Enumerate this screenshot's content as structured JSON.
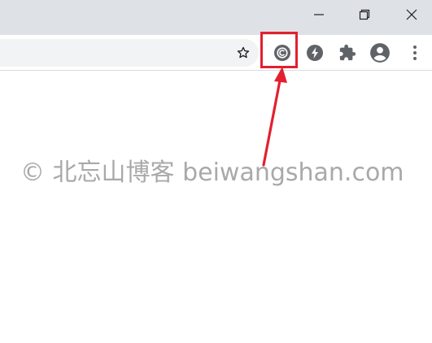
{
  "window_controls": {
    "minimize": "minimize-icon",
    "restore": "restore-icon",
    "close": "close-icon"
  },
  "toolbar": {
    "bookmark_icon": "star-outline-icon",
    "extensions": [
      {
        "name": "copyright-extension-icon",
        "color": "#5f6368"
      },
      {
        "name": "lightning-extension-icon",
        "color": "#5f6368"
      },
      {
        "name": "extensions-puzzle-icon",
        "color": "#5f6368"
      }
    ],
    "profile_icon": "account-circle-icon",
    "menu_icon": "more-vertical-icon"
  },
  "annotation": {
    "highlight_color": "#e2202f"
  },
  "watermark": {
    "text": "© 北忘山博客 beiwangshan.com",
    "color": "#a9a9a9"
  }
}
